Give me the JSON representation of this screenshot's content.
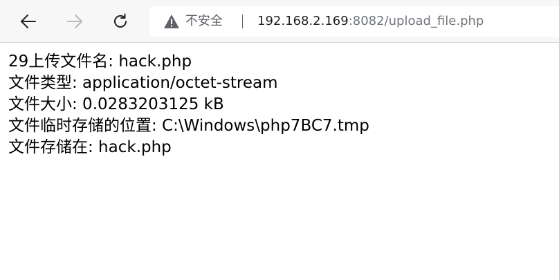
{
  "browser": {
    "security_label": "不安全",
    "url_host": "192.168.2.169",
    "url_rest": ":8082/upload_file.php",
    "icons": {
      "back": "back-arrow-icon",
      "forward": "forward-arrow-icon",
      "reload": "reload-icon",
      "warning": "warning-triangle-icon"
    }
  },
  "page": {
    "lines": [
      "29上传文件名: hack.php",
      "文件类型: application/octet-stream",
      "文件大小: 0.0283203125 kB",
      "文件临时存储的位置: C:\\Windows\\php7BC7.tmp",
      "文件存储在: hack.php"
    ]
  }
}
